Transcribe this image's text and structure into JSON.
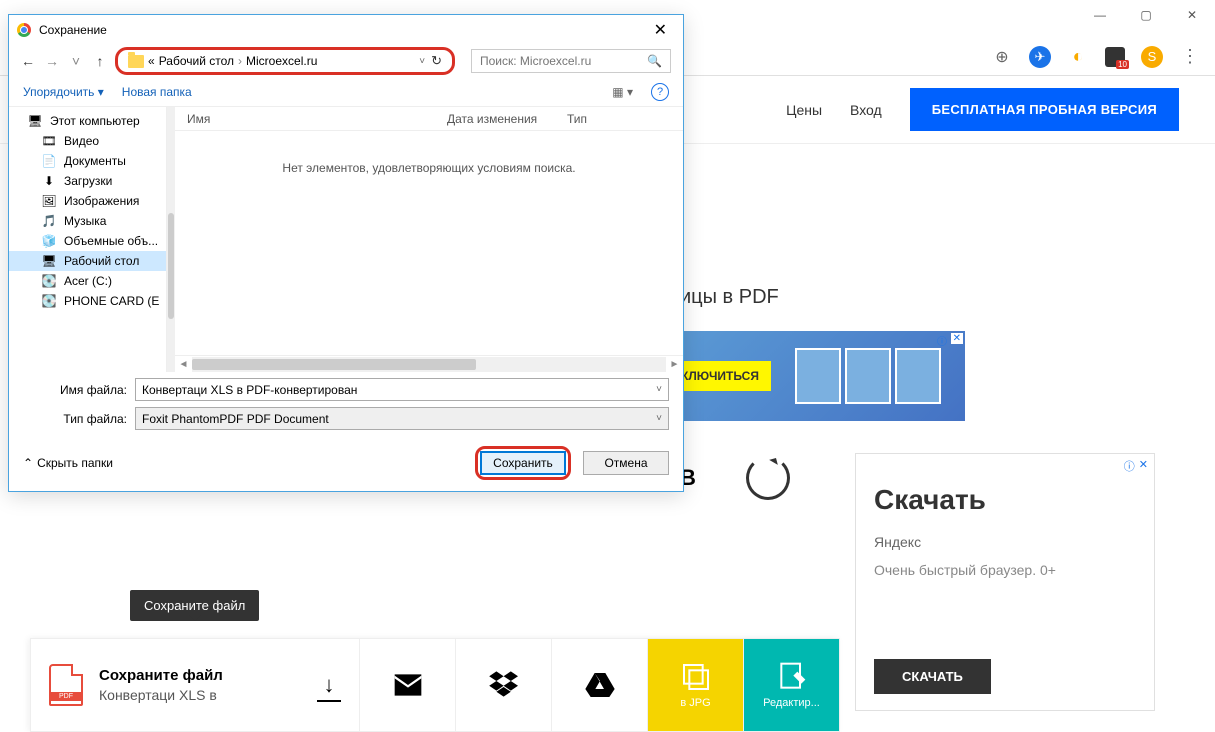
{
  "windowControls": {
    "min": "—",
    "max": "▢",
    "close": "✕"
  },
  "browserBar": {
    "avatar": "S",
    "badge": "10"
  },
  "nav": {
    "prices": "Цены",
    "login": "Вход",
    "trial": "БЕСПЛАТНАЯ ПРОБНАЯ ВЕРСИЯ"
  },
  "hero": {
    "suffix": "ицы в PDF"
  },
  "banner": {
    "cta": "КЛЮЧИТЬСЯ"
  },
  "spinnerRow": {
    "letter": "В"
  },
  "sideAd": {
    "title": "Скачать",
    "brand": "Яндекс",
    "desc": "Очень быстрый браузер. 0+",
    "cta": "СКАЧАТЬ",
    "info": "ⓘ",
    "close": "✕"
  },
  "tooltip": "Сохраните файл",
  "actionBar": {
    "primary": {
      "title": "Сохраните файл",
      "subtitle": "Конвертаци XLS в"
    },
    "jpg": "в JPG",
    "edit": "Редактир..."
  },
  "dialog": {
    "title": "Сохранение",
    "breadcrumb": {
      "prefix": "«",
      "p1": "Рабочий стол",
      "p2": "Microexcel.ru"
    },
    "searchPlaceholder": "Поиск: Microexcel.ru",
    "toolbar": {
      "organize": "Упорядочить",
      "newFolder": "Новая папка"
    },
    "columns": {
      "name": "Имя",
      "date": "Дата изменения",
      "type": "Тип"
    },
    "empty": "Нет элементов, удовлетворяющих условиям поиска.",
    "tree": [
      {
        "icon": "🖥",
        "label": "Этот компьютер",
        "indent": 0
      },
      {
        "icon": "🎞",
        "label": "Видео",
        "indent": 1
      },
      {
        "icon": "📄",
        "label": "Документы",
        "indent": 1
      },
      {
        "icon": "⬇",
        "label": "Загрузки",
        "indent": 1
      },
      {
        "icon": "🖼",
        "label": "Изображения",
        "indent": 1
      },
      {
        "icon": "🎵",
        "label": "Музыка",
        "indent": 1
      },
      {
        "icon": "🧊",
        "label": "Объемные объ...",
        "indent": 1
      },
      {
        "icon": "🖥",
        "label": "Рабочий стол",
        "indent": 1,
        "sel": true
      },
      {
        "icon": "💽",
        "label": "Acer (C:)",
        "indent": 1
      },
      {
        "icon": "💽",
        "label": "PHONE CARD (E",
        "indent": 1
      }
    ],
    "filenameLabel": "Имя файла:",
    "filenameValue": "Конвертаци XLS в PDF-конвертирован",
    "filetypeLabel": "Тип файла:",
    "filetypeValue": "Foxit PhantomPDF PDF Document",
    "hideFolders": "Скрыть папки",
    "save": "Сохранить",
    "cancel": "Отмена"
  }
}
